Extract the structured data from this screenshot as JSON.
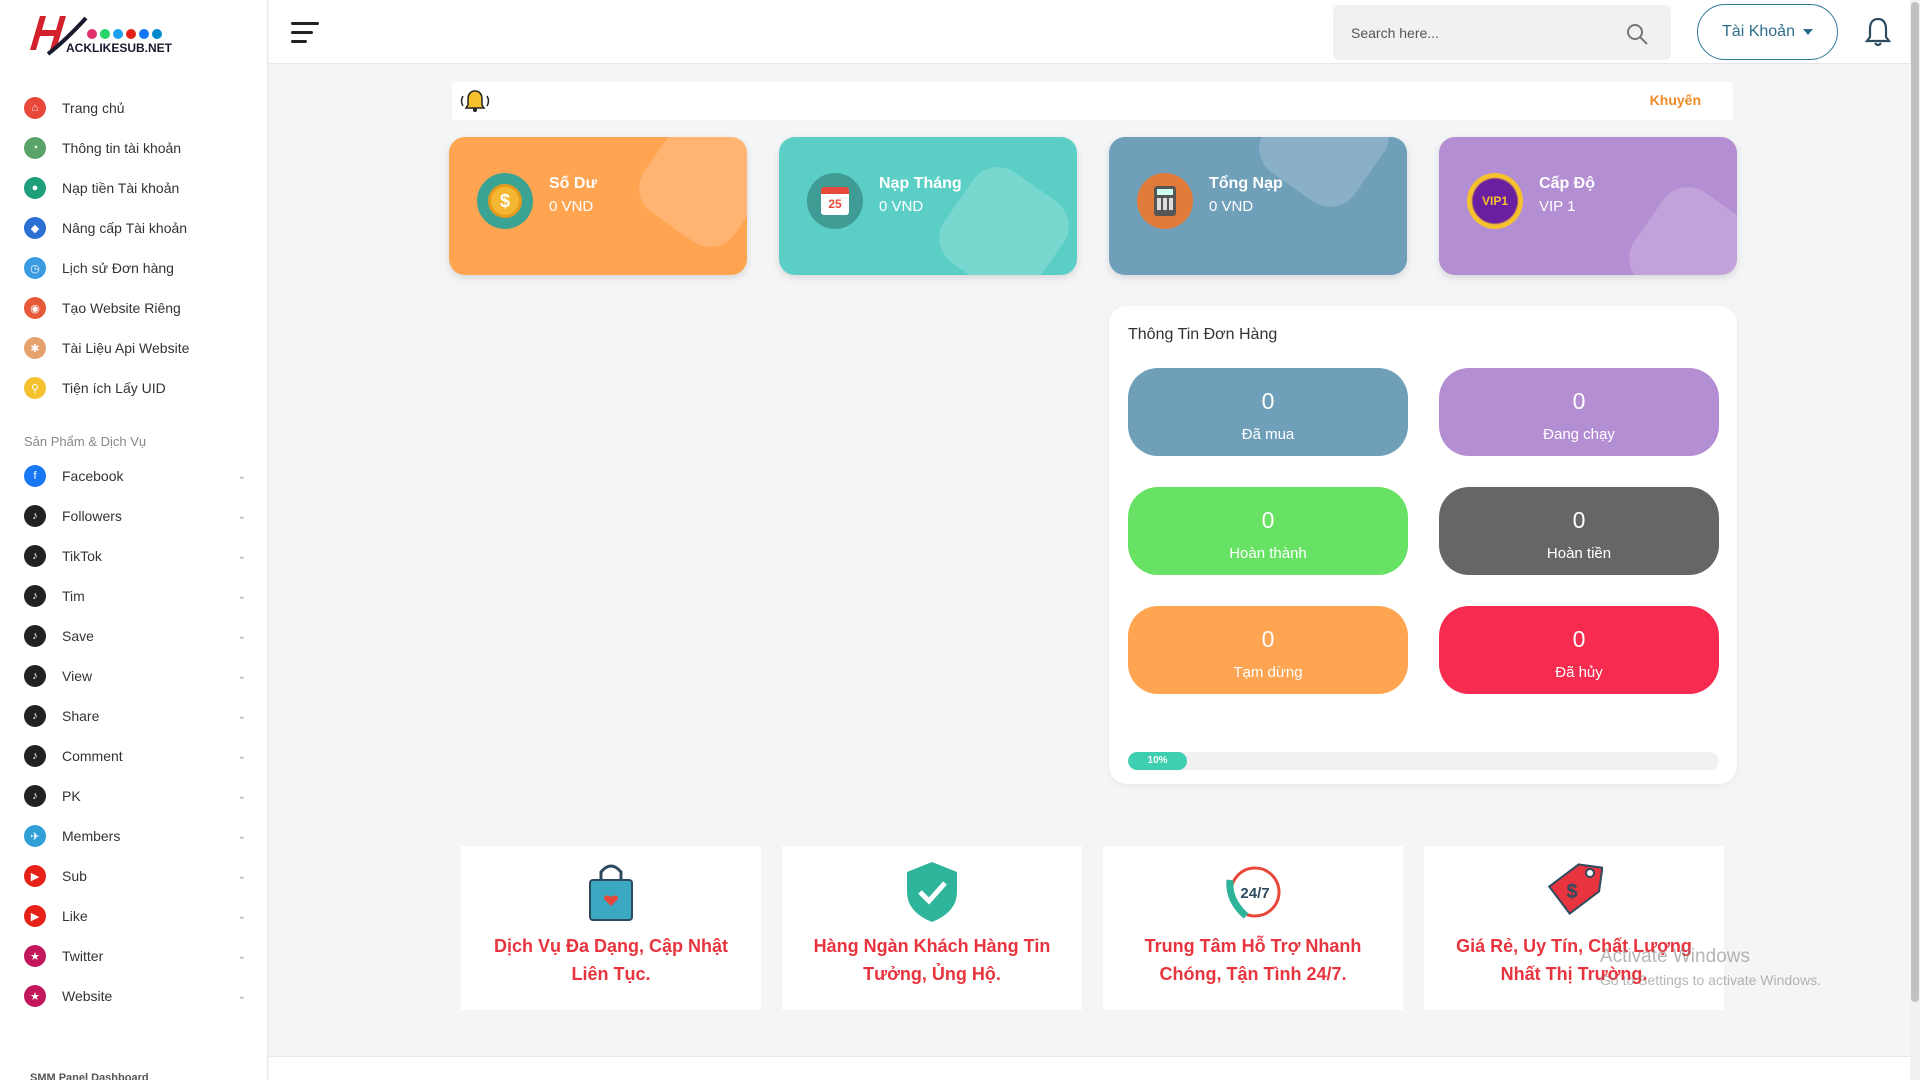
{
  "brand": {
    "logo_text": "ACKLIKESUB.NET"
  },
  "sidebar": {
    "main_items": [
      {
        "label": "Trang chủ",
        "icon": "home-icon",
        "color": "#e8483a"
      },
      {
        "label": "Thông tin tài khoản",
        "icon": "user-info-icon",
        "color": "#5aa469"
      },
      {
        "label": "Nạp tiền Tài khoản",
        "icon": "deposit-icon",
        "color": "#1e9e7a"
      },
      {
        "label": "Nâng cấp Tài khoản",
        "icon": "diamond-icon",
        "color": "#2a6fd1"
      },
      {
        "label": "Lịch sử Đơn hàng",
        "icon": "history-icon",
        "color": "#3b9be0"
      },
      {
        "label": "Tạo Website Riêng",
        "icon": "website-create-icon",
        "color": "#e65a3a"
      },
      {
        "label": "Tài Liệu Api Website",
        "icon": "api-docs-icon",
        "color": "#e6a06b"
      },
      {
        "label": "Tiện ích Lấy UID",
        "icon": "uid-search-icon",
        "color": "#f5c12e"
      }
    ],
    "section_title": "Sản Phẩm & Dịch Vụ",
    "service_items": [
      {
        "label": "Facebook",
        "icon": "facebook-icon",
        "color": "#1877f2"
      },
      {
        "label": "Followers",
        "icon": "tiktok-icon",
        "color": "#222222"
      },
      {
        "label": "TikTok",
        "icon": "tiktok-icon",
        "color": "#222222"
      },
      {
        "label": "Tim",
        "icon": "tiktok-icon",
        "color": "#222222"
      },
      {
        "label": "Save",
        "icon": "tiktok-icon",
        "color": "#222222"
      },
      {
        "label": "View",
        "icon": "tiktok-icon",
        "color": "#222222"
      },
      {
        "label": "Share",
        "icon": "tiktok-icon",
        "color": "#222222"
      },
      {
        "label": "Comment",
        "icon": "tiktok-icon",
        "color": "#222222"
      },
      {
        "label": "PK",
        "icon": "tiktok-icon",
        "color": "#222222"
      },
      {
        "label": "Members",
        "icon": "members-icon",
        "color": "#2f9fd6"
      },
      {
        "label": "Sub",
        "icon": "youtube-icon",
        "color": "#e62117"
      },
      {
        "label": "Like",
        "icon": "youtube-icon",
        "color": "#e62117"
      },
      {
        "label": "Twitter",
        "icon": "star-icon",
        "color": "#c2185b"
      },
      {
        "label": "Website",
        "icon": "star-icon",
        "color": "#c2185b"
      }
    ],
    "footer": "SMM Panel Dashboard"
  },
  "topbar": {
    "search_placeholder": "Search here...",
    "account_label": "Tài Khoản"
  },
  "marquee": {
    "text": "Khuyến"
  },
  "stats": [
    {
      "title": "Số Dư",
      "value": "0 VND",
      "bg": "#ffa552",
      "icon": "coin-icon"
    },
    {
      "title": "Nạp Tháng",
      "value": "0 VND",
      "bg": "#5bcfc5",
      "icon": "calendar-icon",
      "icon_text": "25"
    },
    {
      "title": "Tổng Nạp",
      "value": "0 VND",
      "bg": "#709fba",
      "icon": "calculator-icon"
    },
    {
      "title": "Cấp Độ",
      "value": "VIP 1",
      "bg": "#b48ed2",
      "icon": "vip-badge-icon",
      "icon_text": "VIP1"
    }
  ],
  "orders": {
    "title": "Thông Tin Đơn Hàng",
    "cards": [
      {
        "value": "0",
        "label": "Đã mua",
        "bg": "#709fba"
      },
      {
        "value": "0",
        "label": "Đang chạy",
        "bg": "#b48ed2"
      },
      {
        "value": "0",
        "label": "Hoàn thành",
        "bg": "#67e265"
      },
      {
        "value": "0",
        "label": "Hoàn tiền",
        "bg": "#666666"
      },
      {
        "value": "0",
        "label": "Tạm dừng",
        "bg": "#ffa552"
      },
      {
        "value": "0",
        "label": "Đã hủy",
        "bg": "#f72b50"
      }
    ],
    "progress_percent": 10,
    "progress_label": "10%"
  },
  "features": [
    {
      "text": "Dịch Vụ Đa Dạng, Cập Nhật Liên Tục.",
      "icon": "shopping-bag-icon"
    },
    {
      "text": "Hàng Ngàn Khách Hàng Tin Tưởng, Ủng Hộ.",
      "icon": "shield-check-icon"
    },
    {
      "text": "Trung Tâm Hỗ Trợ Nhanh Chóng, Tận Tình 24/7.",
      "icon": "support-24-7-icon",
      "icon_text": "24/7"
    },
    {
      "text": "Giá Rẻ, Uy Tín, Chất Lượng Nhất Thị Trường.",
      "icon": "price-tag-icon"
    }
  ],
  "watermark": {
    "title": "Activate Windows",
    "subtitle": "Go to Settings to activate Windows."
  }
}
